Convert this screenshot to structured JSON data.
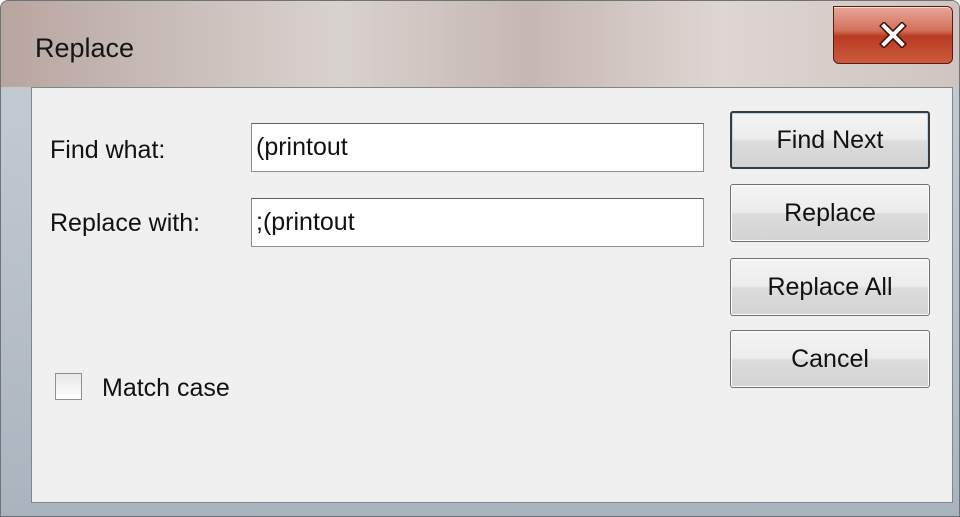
{
  "window": {
    "title": "Replace",
    "close_icon": "close-x-icon"
  },
  "find": {
    "label": "Find what:",
    "value": "(printout"
  },
  "replace": {
    "label": "Replace with:",
    "value": ";(printout"
  },
  "buttons": {
    "find_next": "Find Next",
    "replace": "Replace",
    "replace_all": "Replace All",
    "cancel": "Cancel"
  },
  "options": {
    "match_case_label": "Match case",
    "match_case_checked": false
  }
}
